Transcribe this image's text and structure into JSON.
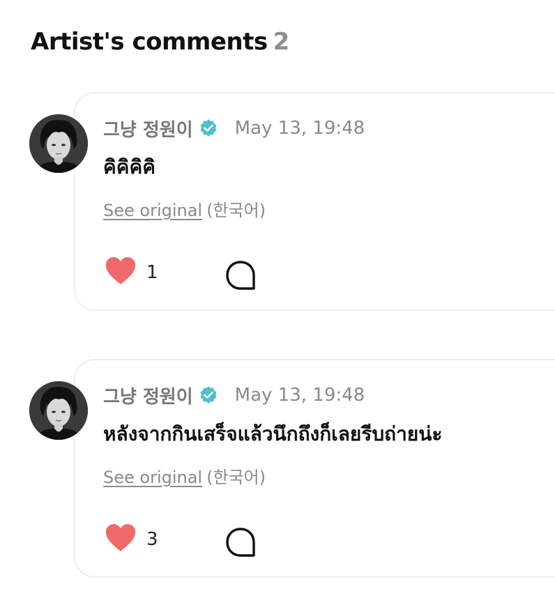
{
  "section": {
    "title": "Artist's comments",
    "count": "2"
  },
  "comments": [
    {
      "author": "그냥 정원이",
      "verified_icon": "verified-check-icon",
      "timestamp": "May 13, 19:48",
      "text": "คิคิคิคิ",
      "see_original": "See original",
      "language": "(한국어)",
      "like_count": "1",
      "like_icon": "heart-icon",
      "reply_icon": "speech-bubble-icon"
    },
    {
      "author": "그냥 정원이",
      "verified_icon": "verified-check-icon",
      "timestamp": "May 13, 19:48",
      "text": "หลังจากกินเสร็จแล้วนึกถึงก็เลยรีบถ่ายน่ะ",
      "see_original": "See original",
      "language": "(한국어)",
      "like_count": "3",
      "like_icon": "heart-icon",
      "reply_icon": "speech-bubble-icon"
    }
  ],
  "colors": {
    "heart": "#f06a6a",
    "verified": "#4dbfd0",
    "card_border": "#ededed",
    "muted_text": "#8a8a8a"
  }
}
